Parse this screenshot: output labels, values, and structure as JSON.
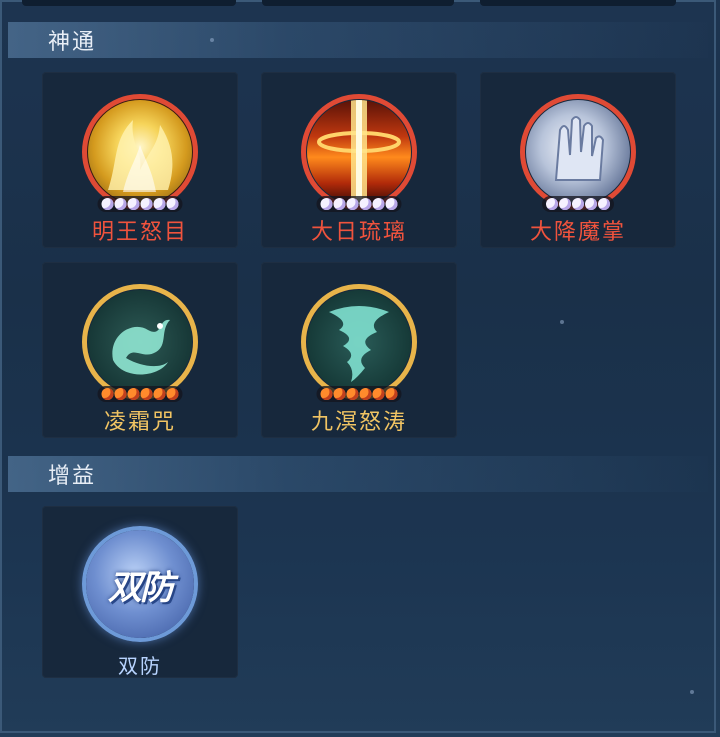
{
  "sections": {
    "shentong": {
      "title": "神通",
      "skills": [
        {
          "name": "明王怒目",
          "icon": "golden-flames-icon",
          "pips": 6,
          "pip_color": "white",
          "ring_color": "#e04a35",
          "label_color": "#f0533d"
        },
        {
          "name": "大日琉璃",
          "icon": "fire-pillar-icon",
          "pips": 6,
          "pip_color": "white",
          "ring_color": "#e04a35",
          "label_color": "#f0533d"
        },
        {
          "name": "大降魔掌",
          "icon": "palm-strike-icon",
          "pips": 5,
          "pip_color": "white",
          "ring_color": "#e04a35",
          "label_color": "#f0533d"
        },
        {
          "name": "凌霜咒",
          "icon": "ice-dragon-icon",
          "pips": 6,
          "pip_color": "orange",
          "ring_color": "#e8b44a",
          "label_color": "#f1c463"
        },
        {
          "name": "九溟怒涛",
          "icon": "water-tornado-icon",
          "pips": 6,
          "pip_color": "orange",
          "ring_color": "#e8b44a",
          "label_color": "#f1c463"
        }
      ]
    },
    "zengyi": {
      "title": "增益",
      "buffs": [
        {
          "name": "双防",
          "icon_text": "双防",
          "icon": "double-defense-icon"
        }
      ]
    }
  }
}
